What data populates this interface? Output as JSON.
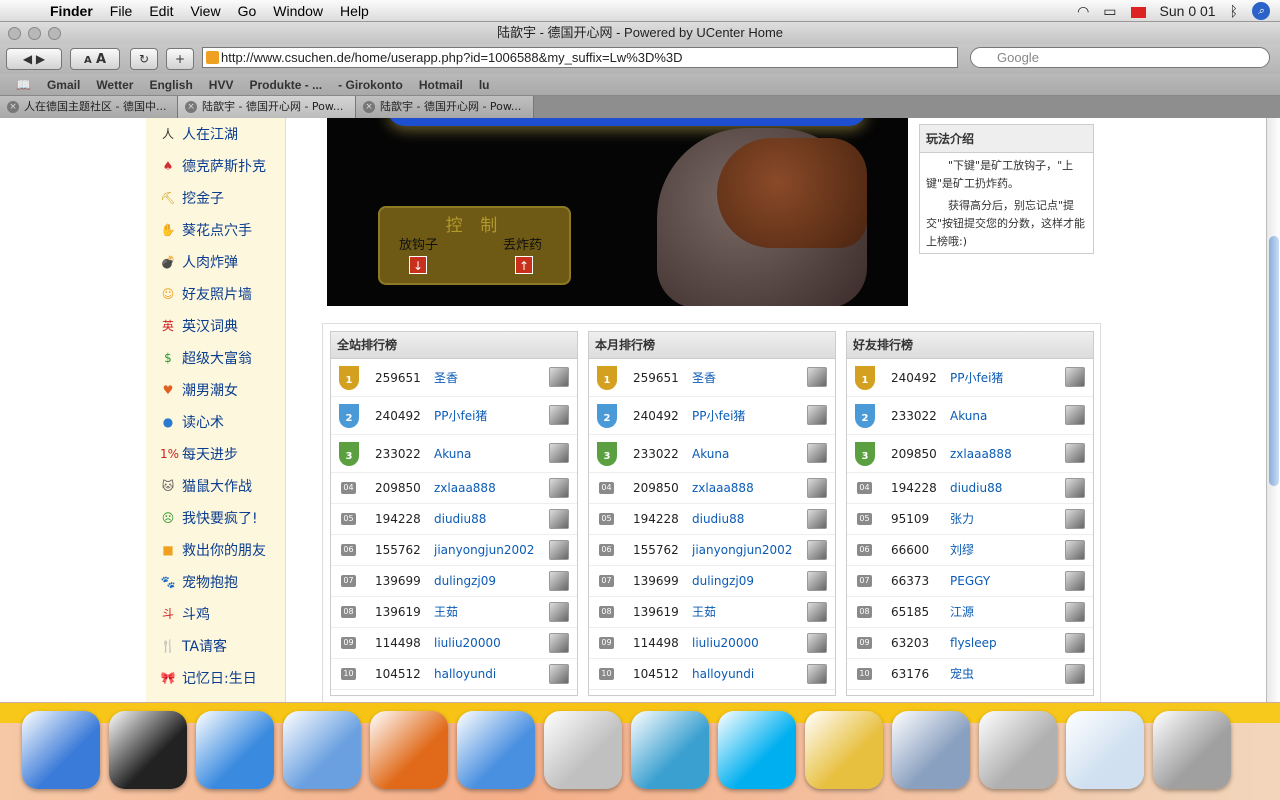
{
  "menubar": {
    "app": "Finder",
    "items": [
      "File",
      "Edit",
      "View",
      "Go",
      "Window",
      "Help"
    ],
    "clock": "Sun 0 01"
  },
  "window": {
    "title": "陆歆宇 - 德国开心网 - Powered by UCenter Home"
  },
  "toolbar": {
    "text_small": "A",
    "text_large": "A",
    "reload": "↻",
    "add": "+",
    "url": "http://www.csuchen.de/home/userapp.php?id=1006588&my_suffix=Lw%3D%3D",
    "search_placeholder": "Google"
  },
  "bookmarks": [
    "Gmail",
    "Wetter",
    "English",
    "HVV",
    "Produkte - ...",
    "- Girokonto",
    "Hotmail",
    "lu"
  ],
  "tabs": [
    {
      "label": "人在德国主题社区 - 德国中..."
    },
    {
      "label": "陆歆宇 - 德国开心网 - Pow..."
    },
    {
      "label": "陆歆宇 - 德国开心网 - Pow..."
    }
  ],
  "sidebar": {
    "items": [
      {
        "label": "人在江湖",
        "icon": "人"
      },
      {
        "label": "德克萨斯扑克",
        "icon": "♠"
      },
      {
        "label": "挖金子",
        "icon": "⛏"
      },
      {
        "label": "葵花点穴手",
        "icon": "✋"
      },
      {
        "label": "人肉炸弹",
        "icon": "💣"
      },
      {
        "label": "好友照片墙",
        "icon": "☺"
      },
      {
        "label": "英汉词典",
        "icon": "英"
      },
      {
        "label": "超级大富翁",
        "icon": "$"
      },
      {
        "label": "潮男潮女",
        "icon": "♥"
      },
      {
        "label": "读心术",
        "icon": "●"
      },
      {
        "label": "每天进步",
        "icon": "1%"
      },
      {
        "label": "猫鼠大作战",
        "icon": "🐱"
      },
      {
        "label": "我快要疯了!",
        "icon": "☹"
      },
      {
        "label": "救出你的朋友",
        "icon": "■"
      },
      {
        "label": "宠物抱抱",
        "icon": "🐾"
      },
      {
        "label": "斗鸡",
        "icon": "斗"
      },
      {
        "label": "TA请客",
        "icon": "🍴"
      },
      {
        "label": "记忆日:生日",
        "icon": "🎀"
      }
    ]
  },
  "game": {
    "control_title": "控 制",
    "hook_label": "放钩子",
    "bomb_label": "丢炸药",
    "hook_key": "↓",
    "bomb_key": "↑"
  },
  "intro": {
    "title": "玩法介绍",
    "p1": "\"下键\"是矿工放钩子，\"上键\"是矿工扔炸药。",
    "p2": "获得高分后，别忘记点\"提交\"按钮提交您的分数，这样才能上榜哦:)"
  },
  "rankings": [
    {
      "title": "全站排行榜",
      "rows": [
        {
          "rank": "1",
          "score": "259651",
          "name": "圣香"
        },
        {
          "rank": "2",
          "score": "240492",
          "name": "PP小fei猪"
        },
        {
          "rank": "3",
          "score": "233022",
          "name": "Akuna"
        },
        {
          "rank": "04",
          "score": "209850",
          "name": "zxlaaa888"
        },
        {
          "rank": "05",
          "score": "194228",
          "name": "diudiu88"
        },
        {
          "rank": "06",
          "score": "155762",
          "name": "jianyongjun2002"
        },
        {
          "rank": "07",
          "score": "139699",
          "name": "dulingzj09"
        },
        {
          "rank": "08",
          "score": "139619",
          "name": "王茹"
        },
        {
          "rank": "09",
          "score": "114498",
          "name": "liuliu20000"
        },
        {
          "rank": "10",
          "score": "104512",
          "name": "halloyundi"
        }
      ]
    },
    {
      "title": "本月排行榜",
      "rows": [
        {
          "rank": "1",
          "score": "259651",
          "name": "圣香"
        },
        {
          "rank": "2",
          "score": "240492",
          "name": "PP小fei猪"
        },
        {
          "rank": "3",
          "score": "233022",
          "name": "Akuna"
        },
        {
          "rank": "04",
          "score": "209850",
          "name": "zxlaaa888"
        },
        {
          "rank": "05",
          "score": "194228",
          "name": "diudiu88"
        },
        {
          "rank": "06",
          "score": "155762",
          "name": "jianyongjun2002"
        },
        {
          "rank": "07",
          "score": "139699",
          "name": "dulingzj09"
        },
        {
          "rank": "08",
          "score": "139619",
          "name": "王茹"
        },
        {
          "rank": "09",
          "score": "114498",
          "name": "liuliu20000"
        },
        {
          "rank": "10",
          "score": "104512",
          "name": "halloyundi"
        }
      ]
    },
    {
      "title": "好友排行榜",
      "rows": [
        {
          "rank": "1",
          "score": "240492",
          "name": "PP小fei猪"
        },
        {
          "rank": "2",
          "score": "233022",
          "name": "Akuna"
        },
        {
          "rank": "3",
          "score": "209850",
          "name": "zxlaaa888"
        },
        {
          "rank": "04",
          "score": "194228",
          "name": "diudiu88"
        },
        {
          "rank": "05",
          "score": "95109",
          "name": "张力"
        },
        {
          "rank": "06",
          "score": "66600",
          "name": "刘缪"
        },
        {
          "rank": "07",
          "score": "66373",
          "name": "PEGGY"
        },
        {
          "rank": "08",
          "score": "65185",
          "name": "江源"
        },
        {
          "rank": "09",
          "score": "63203",
          "name": "flysleep"
        },
        {
          "rank": "10",
          "score": "63176",
          "name": "宠虫"
        }
      ]
    }
  ],
  "dock": {
    "items": [
      {
        "name": "finder",
        "color": "#3a7ad8"
      },
      {
        "name": "dashboard",
        "color": "#222222"
      },
      {
        "name": "safari",
        "color": "#3a8ae0"
      },
      {
        "name": "itunes",
        "color": "#6aa0e0"
      },
      {
        "name": "firefox",
        "color": "#e06a1a"
      },
      {
        "name": "app",
        "color": "#4a90e0"
      },
      {
        "name": "system-preferences",
        "color": "#c0c0c0"
      },
      {
        "name": "messenger",
        "color": "#3aa0d0"
      },
      {
        "name": "skype",
        "color": "#00aff0"
      },
      {
        "name": "folder",
        "color": "#e8c040"
      },
      {
        "name": "iphoto",
        "color": "#8aa0c0"
      },
      {
        "name": "mail",
        "color": "#b0b0b0"
      },
      {
        "name": "screenshot",
        "color": "#d0e0f0"
      },
      {
        "name": "trash",
        "color": "#a0a0a0"
      }
    ]
  }
}
